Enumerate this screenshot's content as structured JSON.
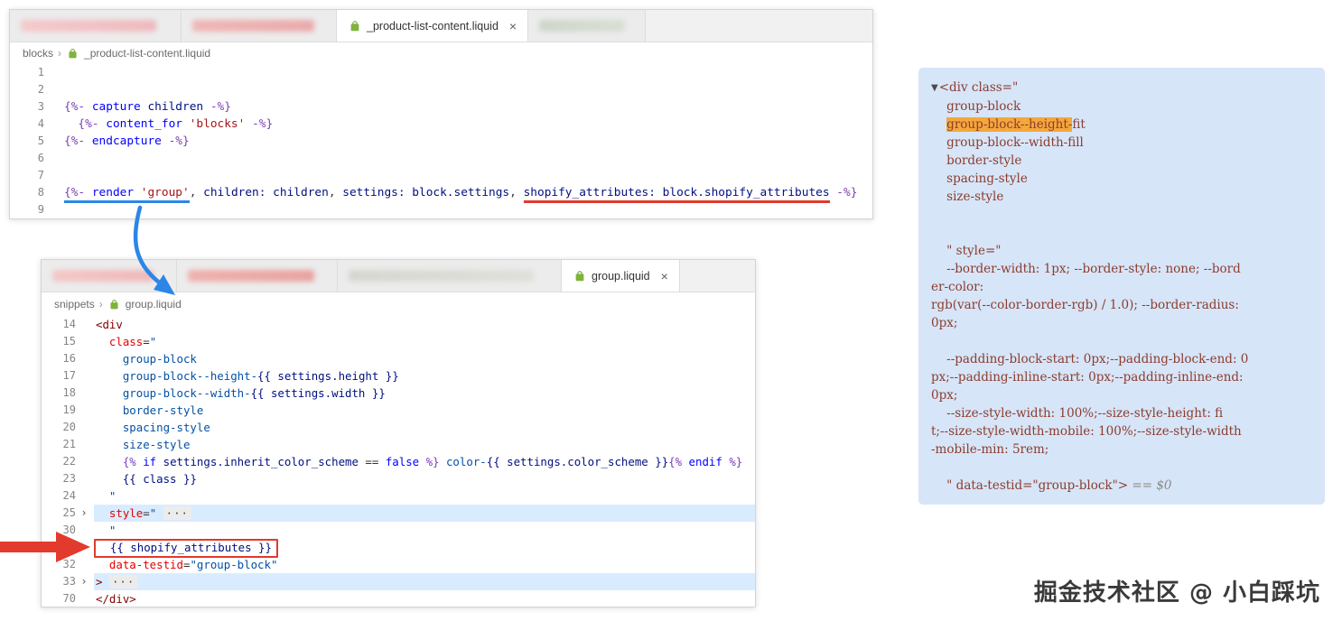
{
  "ui": {
    "close": "×",
    "crumb_sep": "›"
  },
  "colors": {
    "annotation_red": "#e23a2c",
    "annotation_blue": "#2b86e8",
    "search_highlight": "#f5a73b",
    "liquid_icon_green": "#7fb33d",
    "inspector_bg": "#d7e5f8"
  },
  "editor1": {
    "tab": "_product-list-content.liquid",
    "breadcrumb": {
      "folder": "blocks",
      "file": "_product-list-content.liquid"
    },
    "lines": [
      {
        "num": 1,
        "tokens": []
      },
      {
        "num": 2,
        "tokens": []
      },
      {
        "num": 3,
        "tokens": [
          {
            "t": "{%-",
            "c": "d"
          },
          {
            "t": " capture",
            "c": "k"
          },
          {
            "t": " children ",
            "c": "v"
          },
          {
            "t": "-%}",
            "c": "d"
          }
        ]
      },
      {
        "num": 4,
        "tokens": [
          {
            "t": "  ",
            "c": "p"
          },
          {
            "t": "{%-",
            "c": "d"
          },
          {
            "t": " content_for",
            "c": "k"
          },
          {
            "t": " 'blocks'",
            "c": "s"
          },
          {
            "t": " ",
            "c": "p"
          },
          {
            "t": "-%}",
            "c": "d"
          }
        ]
      },
      {
        "num": 5,
        "tokens": [
          {
            "t": "{%-",
            "c": "d"
          },
          {
            "t": " endcapture",
            "c": "k"
          },
          {
            "t": " ",
            "c": "p"
          },
          {
            "t": "-%}",
            "c": "d"
          }
        ]
      },
      {
        "num": 6,
        "tokens": []
      },
      {
        "num": 7,
        "tokens": []
      },
      {
        "num": 8,
        "tokens": [
          {
            "t": "{%-",
            "c": "d",
            "u": "blue"
          },
          {
            "t": " render",
            "c": "k",
            "u": "blue"
          },
          {
            "t": " 'group'",
            "c": "s",
            "u": "blue"
          },
          {
            "t": ",",
            "c": "p"
          },
          {
            "t": " children: children",
            "c": "v"
          },
          {
            "t": ",",
            "c": "p"
          },
          {
            "t": " settings: block.settings",
            "c": "v"
          },
          {
            "t": ", ",
            "c": "p"
          },
          {
            "t": "shopify_attributes: block.shopify_attributes",
            "c": "v",
            "u": "red"
          },
          {
            "t": " ",
            "c": "p"
          },
          {
            "t": "-%}",
            "c": "d"
          }
        ]
      },
      {
        "num": 9,
        "tokens": []
      }
    ]
  },
  "editor2": {
    "tab": "group.liquid",
    "breadcrumb": {
      "folder": "snippets",
      "file": "group.liquid"
    },
    "lines": [
      {
        "num": 14,
        "tokens": [
          {
            "t": "<div",
            "c": "tag"
          }
        ]
      },
      {
        "num": 15,
        "tokens": [
          {
            "t": "  ",
            "c": "p"
          },
          {
            "t": "class",
            "c": "a"
          },
          {
            "t": "=",
            "c": "p"
          },
          {
            "t": "\"",
            "c": "val"
          }
        ]
      },
      {
        "num": 16,
        "tokens": [
          {
            "t": "    group-block",
            "c": "val"
          }
        ]
      },
      {
        "num": 17,
        "tokens": [
          {
            "t": "    group-block--height-",
            "c": "val"
          },
          {
            "t": "{{ settings.height }}",
            "c": "v"
          }
        ]
      },
      {
        "num": 18,
        "tokens": [
          {
            "t": "    group-block--width-",
            "c": "val"
          },
          {
            "t": "{{ settings.width }}",
            "c": "v"
          }
        ]
      },
      {
        "num": 19,
        "tokens": [
          {
            "t": "    border-style",
            "c": "val"
          }
        ]
      },
      {
        "num": 20,
        "tokens": [
          {
            "t": "    spacing-style",
            "c": "val"
          }
        ]
      },
      {
        "num": 21,
        "tokens": [
          {
            "t": "    size-style",
            "c": "val"
          }
        ]
      },
      {
        "num": 22,
        "tokens": [
          {
            "t": "    ",
            "c": "p"
          },
          {
            "t": "{%",
            "c": "d"
          },
          {
            "t": " if",
            "c": "k"
          },
          {
            "t": " settings.inherit_color_scheme ",
            "c": "v"
          },
          {
            "t": "== ",
            "c": "p"
          },
          {
            "t": "false",
            "c": "k"
          },
          {
            "t": " ",
            "c": "p"
          },
          {
            "t": "%}",
            "c": "d"
          },
          {
            "t": " color-",
            "c": "val"
          },
          {
            "t": "{{ settings.color_scheme }}",
            "c": "v"
          },
          {
            "t": "{%",
            "c": "d"
          },
          {
            "t": " endif",
            "c": "k"
          },
          {
            "t": " ",
            "c": "p"
          },
          {
            "t": "%}",
            "c": "d"
          }
        ]
      },
      {
        "num": 23,
        "tokens": [
          {
            "t": "    ",
            "c": "p"
          },
          {
            "t": "{{ class }}",
            "c": "v"
          }
        ]
      },
      {
        "num": 24,
        "tokens": [
          {
            "t": "  \"",
            "c": "val"
          }
        ]
      },
      {
        "num": 25,
        "fold": true,
        "bg": true,
        "tokens": [
          {
            "t": "  ",
            "c": "p"
          },
          {
            "t": "style",
            "c": "a"
          },
          {
            "t": "=",
            "c": "p"
          },
          {
            "t": "\"",
            "c": "val"
          },
          {
            "t": " ",
            "c": "p"
          },
          {
            "t": "···",
            "c": "fold"
          }
        ]
      },
      {
        "num": 30,
        "tokens": [
          {
            "t": "  \"",
            "c": "val"
          }
        ]
      },
      {
        "num": null,
        "boxed": true,
        "tokens": [
          {
            "t": "  ",
            "c": "p"
          },
          {
            "t": "{{ shopify_attributes }}",
            "c": "v"
          }
        ]
      },
      {
        "num": 32,
        "tokens": [
          {
            "t": "  ",
            "c": "p"
          },
          {
            "t": "data-testid",
            "c": "a"
          },
          {
            "t": "=",
            "c": "p"
          },
          {
            "t": "\"group-block\"",
            "c": "val"
          }
        ]
      },
      {
        "num": 33,
        "fold": true,
        "bg": true,
        "tokens": [
          {
            "t": ">",
            "c": "tag"
          },
          {
            "t": " ",
            "c": "p"
          },
          {
            "t": "···",
            "c": "fold"
          }
        ]
      },
      {
        "num": 70,
        "tokens": [
          {
            "t": "</div>",
            "c": "tag"
          }
        ]
      }
    ]
  },
  "inspector": {
    "lines": [
      {
        "segs": [
          {
            "t": "▼",
            "cls": "arrow"
          },
          {
            "t": "<div class=\""
          }
        ]
      },
      {
        "segs": [
          {
            "t": "    group-block"
          }
        ]
      },
      {
        "segs": [
          {
            "t": "    "
          },
          {
            "t": "group-block--height-",
            "hl": true
          },
          {
            "t": "fit"
          }
        ]
      },
      {
        "segs": [
          {
            "t": "    group-block--width-fill"
          }
        ]
      },
      {
        "segs": [
          {
            "t": "    border-style"
          }
        ]
      },
      {
        "segs": [
          {
            "t": "    spacing-style"
          }
        ]
      },
      {
        "segs": [
          {
            "t": "    size-style"
          }
        ]
      },
      {
        "segs": []
      },
      {
        "segs": []
      },
      {
        "segs": [
          {
            "t": "    \" style=\""
          }
        ]
      },
      {
        "segs": [
          {
            "t": "    --border-width: 1px; --border-style: none; --bord"
          }
        ]
      },
      {
        "segs": [
          {
            "t": "er-color:"
          }
        ]
      },
      {
        "segs": [
          {
            "t": "rgb(var(--color-border-rgb) / 1.0); --border-radius:"
          }
        ]
      },
      {
        "segs": [
          {
            "t": "0px;"
          }
        ]
      },
      {
        "segs": []
      },
      {
        "segs": [
          {
            "t": "    --padding-block-start: 0px;--padding-block-end: 0"
          }
        ]
      },
      {
        "segs": [
          {
            "t": "px;--padding-inline-start: 0px;--padding-inline-end:"
          }
        ]
      },
      {
        "segs": [
          {
            "t": "0px;"
          }
        ]
      },
      {
        "segs": [
          {
            "t": "    --size-style-width: 100%;--size-style-height: fi"
          }
        ]
      },
      {
        "segs": [
          {
            "t": "t;--size-style-width-mobile: 100%;--size-style-width"
          }
        ]
      },
      {
        "segs": [
          {
            "t": "-mobile-min: 5rem;"
          }
        ]
      },
      {
        "segs": []
      },
      {
        "segs": [
          {
            "t": "    \" data-testid=\"group-block\"> "
          },
          {
            "t": "== $0",
            "cls": "muted"
          }
        ]
      }
    ]
  },
  "watermark": "掘金技术社区 @ 小白踩坑"
}
